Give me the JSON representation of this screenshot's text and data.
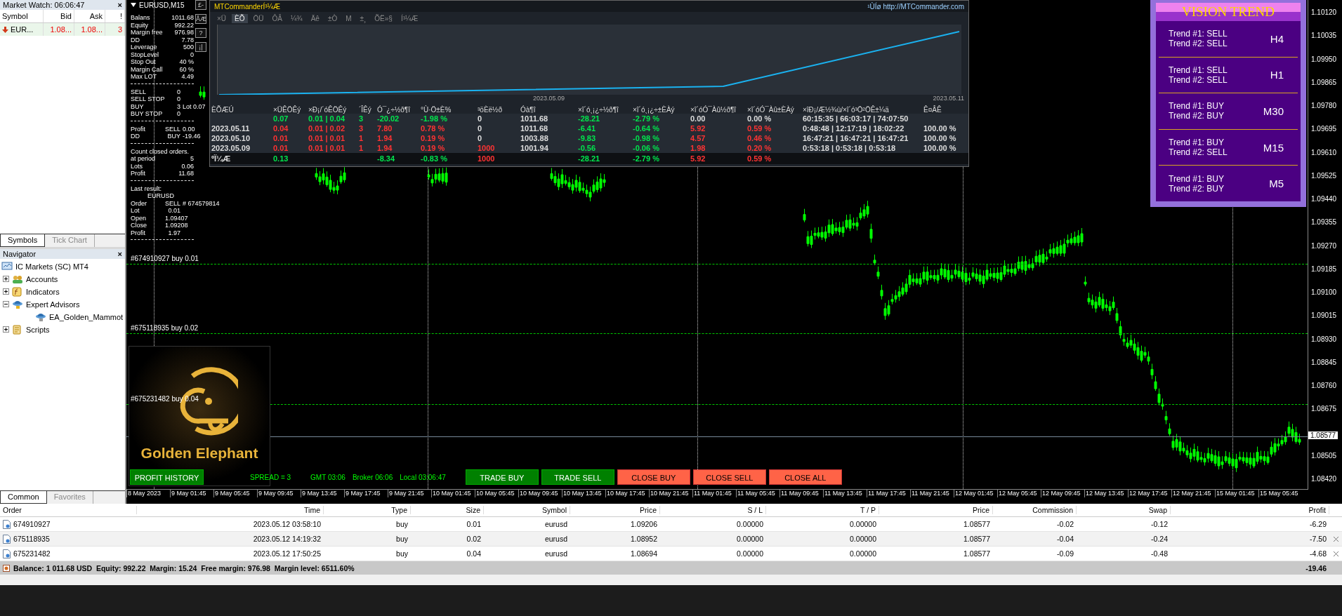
{
  "market_watch": {
    "title": "Market Watch: 06:06:47",
    "close": "×",
    "columns": [
      "Symbol",
      "Bid",
      "Ask",
      "!"
    ],
    "rows": [
      {
        "symbol": "EUR...",
        "bid": "1.08...",
        "ask": "1.08...",
        "spread": "3"
      }
    ],
    "tabs": [
      {
        "label": "Symbols",
        "selected": true
      },
      {
        "label": "Tick Chart",
        "selected": false
      }
    ]
  },
  "navigator": {
    "title": "Navigator",
    "close": "×",
    "tree": [
      {
        "label": "IC Markets (SC) MT4",
        "kind": "terminal",
        "children": [
          {
            "label": "Accounts",
            "kind": "accounts",
            "expanded": false
          },
          {
            "label": "Indicators",
            "kind": "indicators",
            "expanded": false
          },
          {
            "label": "Expert Advisors",
            "kind": "experts",
            "expanded": true,
            "children": [
              {
                "label": "EA_Golden_Mammot",
                "kind": "expert"
              }
            ]
          },
          {
            "label": "Scripts",
            "kind": "scripts",
            "expanded": false
          }
        ]
      }
    ],
    "tabs": [
      {
        "label": "Common",
        "selected": true
      },
      {
        "label": "Favorites",
        "selected": false
      }
    ]
  },
  "chart": {
    "title": "EURUSD,M15",
    "info_buttons": [
      "£-",
      "ÅÆ",
      "?",
      "¡|"
    ],
    "info_sections": [
      {
        "rows": [
          {
            "kind": "pair",
            "cells": [
              "Balans",
              "1011.68"
            ]
          },
          {
            "kind": "pair",
            "cells": [
              "Equity",
              "992.22"
            ]
          },
          {
            "kind": "pair",
            "cells": [
              "Margin free",
              "976.98"
            ]
          },
          {
            "kind": "pair",
            "cells": [
              "DD",
              "7.78"
            ]
          },
          {
            "kind": "pair",
            "cells": [
              "Leverage",
              "500"
            ]
          },
          {
            "kind": "pair",
            "cells": [
              "StopLevel",
              "0"
            ]
          },
          {
            "kind": "pair",
            "cells": [
              "Stop Out",
              "40 %"
            ]
          },
          {
            "kind": "pair",
            "cells": [
              "Margin Call",
              "60 %"
            ]
          },
          {
            "kind": "pair",
            "cells": [
              "Max LOT",
              "4.49"
            ]
          }
        ]
      },
      {
        "rows": [
          {
            "kind": "triple",
            "cells": [
              "SELL",
              "0"
            ]
          },
          {
            "kind": "triple",
            "cells": [
              "SELL STOP",
              "0"
            ]
          },
          {
            "kind": "triple",
            "cells": [
              "BUY",
              "3",
              "Lot 0.07"
            ]
          },
          {
            "kind": "triple",
            "cells": [
              "BUY STOP",
              "0"
            ]
          }
        ]
      },
      {
        "rows": [
          {
            "kind": "triple",
            "cells": [
              "Profit",
              "SELL",
              "0.00"
            ]
          },
          {
            "kind": "triple",
            "cells": [
              "DD",
              "BUY",
              "-19.46"
            ]
          }
        ]
      },
      {
        "rows": [
          {
            "kind": "note",
            "cells": [
              "Count closed orders."
            ]
          },
          {
            "kind": "pair",
            "cells": [
              "at period",
              "5"
            ]
          },
          {
            "kind": "pair",
            "cells": [
              "Lots",
              "0.06"
            ]
          },
          {
            "kind": "pair",
            "cells": [
              "Profit",
              "11.68"
            ]
          }
        ]
      },
      {
        "rows": [
          {
            "kind": "note",
            "cells": [
              "Last result:"
            ]
          },
          {
            "kind": "indented",
            "cells": [
              "EURUSD"
            ]
          },
          {
            "kind": "triple",
            "cells": [
              "Order",
              "SELL",
              "# 674579814"
            ]
          },
          {
            "kind": "triple",
            "cells": [
              "Lot",
              "0.01"
            ]
          },
          {
            "kind": "triple",
            "cells": [
              "Open",
              "1.09407"
            ]
          },
          {
            "kind": "triple",
            "cells": [
              "Close",
              "1.09208"
            ]
          },
          {
            "kind": "triple",
            "cells": [
              "Profit",
              "1.97"
            ]
          }
        ]
      }
    ],
    "order_labels": [
      "#674910927 buy 0.01",
      "#675118935 buy 0.02",
      "#675231482 buy 0.04"
    ],
    "price_axis": [
      "1.10120",
      "1.10035",
      "1.09950",
      "1.09865",
      "1.09780",
      "1.09695",
      "1.09610",
      "1.09525",
      "1.09440",
      "1.09355",
      "1.09270",
      "1.09185",
      "1.09100",
      "1.09015",
      "1.08930",
      "1.08845",
      "1.08760",
      "1.08675",
      "1.08505",
      "1.08420"
    ],
    "current_price": "1.08577",
    "time_axis": [
      "8 May 2023",
      "9 May 01:45",
      "9 May 05:45",
      "9 May 09:45",
      "9 May 13:45",
      "9 May 17:45",
      "9 May 21:45",
      "10 May 01:45",
      "10 May 05:45",
      "10 May 09:45",
      "10 May 13:45",
      "10 May 17:45",
      "10 May 21:45",
      "11 May 01:45",
      "11 May 05:45",
      "11 May 09:45",
      "11 May 13:45",
      "11 May 17:45",
      "11 May 21:45",
      "12 May 01:45",
      "12 May 05:45",
      "12 May 09:45",
      "12 May 13:45",
      "12 May 17:45",
      "12 May 21:45",
      "15 May 01:45",
      "15 May 05:45"
    ],
    "logo_text": "Golden Elephant",
    "toolbar": [
      {
        "kind": "history",
        "label": "PROFIT HISTORY"
      },
      {
        "kind": "status",
        "label": "SPREAD = 3"
      },
      {
        "kind": "clock",
        "label": "GMT 03:06"
      },
      {
        "kind": "clock",
        "label": "Broker 06:06"
      },
      {
        "kind": "clock",
        "label": "Local 03:06:47"
      },
      {
        "kind": "trade",
        "label": "TRADE BUY"
      },
      {
        "kind": "trade",
        "label": "TRADE SELL"
      },
      {
        "kind": "close",
        "label": "CLOSE BUY"
      },
      {
        "kind": "close",
        "label": "CLOSE SELL"
      },
      {
        "kind": "close",
        "label": "CLOSE ALL"
      }
    ]
  },
  "mt_commander": {
    "title": "MTCommanderÍ³¼Æ",
    "link": "¹ÙÍø http://MTCommander.com",
    "tabs": [
      {
        "label": "×Ü",
        "selected": false
      },
      {
        "label": "ÈÕ",
        "selected": true
      },
      {
        "label": "ÖÜ",
        "selected": false
      },
      {
        "label": "ÔÂ",
        "selected": false
      },
      {
        "label": "¼¾",
        "selected": false
      },
      {
        "label": "Äê",
        "selected": false
      },
      {
        "label": "±Ò",
        "selected": false
      },
      {
        "label": "M",
        "selected": false
      },
      {
        "label": "±¸",
        "selected": false
      },
      {
        "label": "ÕË»§",
        "selected": false
      },
      {
        "label": "Í³¼Æ",
        "selected": false
      }
    ],
    "chart_labels": [
      "2023.05.09",
      "2023.05.11"
    ],
    "columns": [
      "ÈÕÆÚ",
      "×ÜÊÖÊý",
      "×Ð¡/´óÊÖÊý",
      "´ÎÊý",
      "Ó¯¿÷½ð¶î",
      "°Ù·Ö±È%",
      "³öÈë½ð",
      "Óà¶î",
      "×î´ó¸¡¿÷½ð¶î",
      "×î´ó¸¡¿÷±ÈÀý",
      "×î´óÓ¯Àû½ð¶î",
      "×î´óÓ¯Àû±ÈÀý",
      "×îÐ¡/Æ½¾ù/×î´ó³Ö²ÖÊ±¼ä",
      "Ê¤ÂÊ"
    ],
    "rows": [
      {
        "total": false,
        "cells": [
          null,
          {
            "text": "0.07",
            "color": "#00e64d"
          },
          {
            "text": "0.01 | 0.04",
            "color": "#00e64d"
          },
          {
            "text": "3",
            "color": "#00e64d"
          },
          {
            "text": "-20.02",
            "color": "#00e64d"
          },
          {
            "text": "-1.98 %",
            "color": "#00e64d"
          },
          {
            "text": "0",
            "color": "#dddddd"
          },
          {
            "text": "1011.68",
            "color": "#dddddd"
          },
          {
            "text": "-28.21",
            "color": "#00e64d"
          },
          {
            "text": "-2.79 %",
            "color": "#00e64d"
          },
          {
            "text": "0.00",
            "color": "#dddddd"
          },
          {
            "text": "0.00 %",
            "color": "#dddddd"
          },
          {
            "text": "60:15:35 | 66:03:17 | 74:07:50",
            "color": "#dddddd"
          },
          null
        ]
      },
      {
        "total": false,
        "cells": [
          {
            "text": "2023.05.11",
            "color": "#dddddd"
          },
          {
            "text": "0.04",
            "color": "#ff3333"
          },
          {
            "text": "0.01 | 0.02",
            "color": "#ff3333"
          },
          {
            "text": "3",
            "color": "#ff3333"
          },
          {
            "text": "7.80",
            "color": "#ff3333"
          },
          {
            "text": "0.78 %",
            "color": "#ff3333"
          },
          {
            "text": "0",
            "color": "#dddddd"
          },
          {
            "text": "1011.68",
            "color": "#dddddd"
          },
          {
            "text": "-6.41",
            "color": "#00e64d"
          },
          {
            "text": "-0.64 %",
            "color": "#00e64d"
          },
          {
            "text": "5.92",
            "color": "#ff3333"
          },
          {
            "text": "0.59 %",
            "color": "#ff3333"
          },
          {
            "text": "0:48:48 | 12:17:19 | 18:02:22",
            "color": "#dddddd"
          },
          {
            "text": "100.00 %",
            "color": "#dddddd"
          }
        ]
      },
      {
        "total": false,
        "cells": [
          {
            "text": "2023.05.10",
            "color": "#dddddd"
          },
          {
            "text": "0.01",
            "color": "#ff3333"
          },
          {
            "text": "0.01 | 0.01",
            "color": "#ff3333"
          },
          {
            "text": "1",
            "color": "#ff3333"
          },
          {
            "text": "1.94",
            "color": "#ff3333"
          },
          {
            "text": "0.19 %",
            "color": "#ff3333"
          },
          {
            "text": "0",
            "color": "#dddddd"
          },
          {
            "text": "1003.88",
            "color": "#dddddd"
          },
          {
            "text": "-9.83",
            "color": "#00e64d"
          },
          {
            "text": "-0.98 %",
            "color": "#00e64d"
          },
          {
            "text": "4.57",
            "color": "#ff3333"
          },
          {
            "text": "0.46 %",
            "color": "#ff3333"
          },
          {
            "text": "16:47:21 | 16:47:21 | 16:47:21",
            "color": "#dddddd"
          },
          {
            "text": "100.00 %",
            "color": "#dddddd"
          }
        ]
      },
      {
        "total": false,
        "cells": [
          {
            "text": "2023.05.09",
            "color": "#dddddd"
          },
          {
            "text": "0.01",
            "color": "#ff3333"
          },
          {
            "text": "0.01 | 0.01",
            "color": "#ff3333"
          },
          {
            "text": "1",
            "color": "#ff3333"
          },
          {
            "text": "1.94",
            "color": "#ff3333"
          },
          {
            "text": "0.19 %",
            "color": "#ff3333"
          },
          {
            "text": "1000",
            "color": "#ff3333"
          },
          {
            "text": "1001.94",
            "color": "#dddddd"
          },
          {
            "text": "-0.56",
            "color": "#00e64d"
          },
          {
            "text": "-0.06 %",
            "color": "#00e64d"
          },
          {
            "text": "1.98",
            "color": "#ff3333"
          },
          {
            "text": "0.20 %",
            "color": "#ff3333"
          },
          {
            "text": "0:53:18 | 0:53:18 | 0:53:18",
            "color": "#dddddd"
          },
          {
            "text": "100.00 %",
            "color": "#dddddd"
          }
        ]
      },
      {
        "total": true,
        "cells": [
          {
            "text": "ºÏ¼Æ",
            "color": "#dddddd"
          },
          {
            "text": "0.13",
            "color": "#00e64d"
          },
          null,
          null,
          {
            "text": "-8.34",
            "color": "#00e64d"
          },
          {
            "text": "-0.83 %",
            "color": "#00e64d"
          },
          {
            "text": "1000",
            "color": "#ff3333"
          },
          null,
          {
            "text": "-28.21",
            "color": "#00e64d"
          },
          {
            "text": "-2.79 %",
            "color": "#00e64d"
          },
          {
            "text": "5.92",
            "color": "#ff3333"
          },
          {
            "text": "0.59 %",
            "color": "#ff3333"
          },
          null,
          null
        ]
      }
    ]
  },
  "vision_trend": {
    "title": "VISION TREND",
    "rows": [
      {
        "trend_1": "Trend #1: SELL",
        "trend_2": "Trend #2: SELL",
        "timeframe": "H4"
      },
      {
        "trend_1": "Trend #1: SELL",
        "trend_2": "Trend #2: SELL",
        "timeframe": "H1"
      },
      {
        "trend_1": "Trend #1: BUY",
        "trend_2": "Trend #2: BUY",
        "timeframe": "M30"
      },
      {
        "trend_1": "Trend #1: BUY",
        "trend_2": "Trend #2: SELL",
        "timeframe": "M15"
      },
      {
        "trend_1": "Trend #1: BUY",
        "trend_2": "Trend #2: BUY",
        "timeframe": "M5"
      }
    ]
  },
  "terminal": {
    "columns": [
      "Order",
      "Time",
      "Type",
      "Size",
      "Symbol",
      "Price",
      "S / L",
      "T / P",
      "Price",
      "Commission",
      "Swap",
      "Profit"
    ],
    "rows": [
      {
        "closable": false,
        "cells": [
          "674910927",
          "2023.05.12 03:58:10",
          "buy",
          "0.01",
          "eurusd",
          "1.09206",
          "0.00000",
          "0.00000",
          "1.08577",
          "-0.02",
          "-0.12",
          "-6.29"
        ]
      },
      {
        "closable": true,
        "cells": [
          "675118935",
          "2023.05.12 14:19:32",
          "buy",
          "0.02",
          "eurusd",
          "1.08952",
          "0.00000",
          "0.00000",
          "1.08577",
          "-0.04",
          "-0.24",
          "-7.50"
        ]
      },
      {
        "closable": true,
        "cells": [
          "675231482",
          "2023.05.12 17:50:25",
          "buy",
          "0.04",
          "eurusd",
          "1.08694",
          "0.00000",
          "0.00000",
          "1.08577",
          "-0.09",
          "-0.48",
          "-4.68"
        ]
      }
    ],
    "summary": "Balance: 1 011.68 USD  Equity: 992.22  Margin: 15.24  Free margin: 976.98  Margin level: 6511.60%",
    "total_profit": "-19.46"
  }
}
